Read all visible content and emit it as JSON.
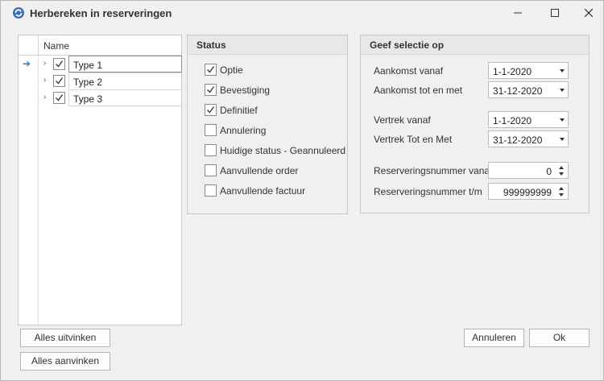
{
  "window": {
    "title": "Herbereken in reserveringen"
  },
  "tree": {
    "header": "Name",
    "rows": [
      {
        "label": "Type 1",
        "checked": true
      },
      {
        "label": "Type 2",
        "checked": true
      },
      {
        "label": "Type 3",
        "checked": true
      }
    ]
  },
  "status": {
    "title": "Status",
    "items": [
      {
        "label": "Optie",
        "checked": true
      },
      {
        "label": "Bevestiging",
        "checked": true
      },
      {
        "label": "Definitief",
        "checked": true
      },
      {
        "label": "Annulering",
        "checked": false
      },
      {
        "label": "Huidige status - Geannuleerd",
        "checked": false
      },
      {
        "label": "Aanvullende order",
        "checked": false
      },
      {
        "label": "Aanvullende factuur",
        "checked": false
      }
    ]
  },
  "selection": {
    "title": "Geef selectie op",
    "arrival_from": {
      "label": "Aankomst vanaf",
      "value": "1-1-2020"
    },
    "arrival_to": {
      "label": "Aankomst tot en met",
      "value": "31-12-2020"
    },
    "departure_from": {
      "label": "Vertrek vanaf",
      "value": "1-1-2020"
    },
    "departure_to": {
      "label": "Vertrek Tot en Met",
      "value": "31-12-2020"
    },
    "resnr_from": {
      "label": "Reserveringsnummer vanaf",
      "value": "0"
    },
    "resnr_to": {
      "label": "Reserveringsnummer t/m",
      "value": "999999999"
    }
  },
  "buttons": {
    "uncheck_all": "Alles uitvinken",
    "check_all": "Alles aanvinken",
    "cancel": "Annuleren",
    "ok": "Ok"
  },
  "colors": {
    "accent": "#2a7bd4",
    "app_icon": "#3b6fb6"
  }
}
